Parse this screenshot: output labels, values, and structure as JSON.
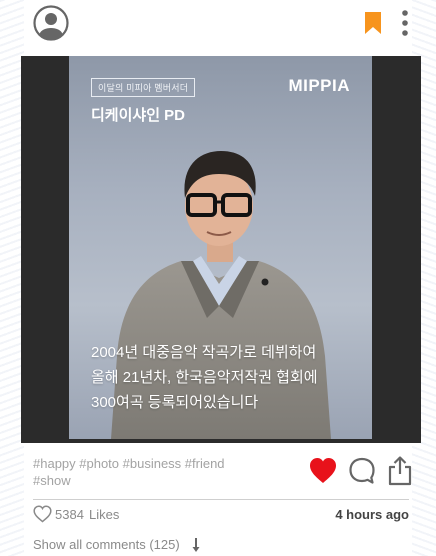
{
  "post": {
    "image": {
      "badge": "이달의 미피아 멤버서더",
      "title": "디케이샤인 PD",
      "brand": "MIPPIA",
      "caption_lines": [
        "2004년 대중음악 작곡가로 데뷔하여",
        "올해 21년차, 한국음악저작권 협회에",
        "300여곡 등록되어있습니다"
      ]
    },
    "hashtags": "#happy #photo #business #friend #show",
    "likes": {
      "count": "5384",
      "label": "Likes"
    },
    "timestamp": "4 hours ago",
    "comments_link": "Show all comments (125)"
  },
  "icons": {
    "avatar": "user-circle",
    "bookmark": "bookmark",
    "more": "more-vertical",
    "like": "heart-filled",
    "comment": "chat-bubble",
    "share": "share-upload",
    "like_small": "heart-outline",
    "arrow": "arrow-down"
  },
  "colors": {
    "bookmark": "#f7941d",
    "like": "#e8121b",
    "icon_gray": "#666666",
    "muted_text": "#8a8a8a",
    "hashtag_text": "#a3a3a3"
  }
}
